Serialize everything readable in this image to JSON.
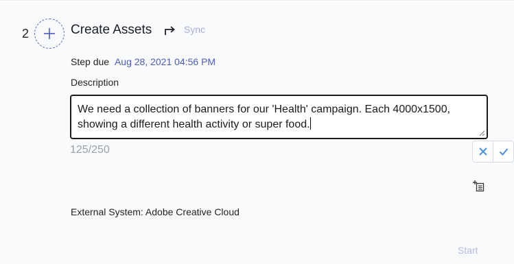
{
  "step": {
    "number": "2",
    "title": "Create Assets",
    "sync_label": "Sync",
    "due_label": "Step due",
    "due_value": "Aug 28, 2021 04:56 PM",
    "description_label": "Description",
    "description_value": "We need a collection of banners for our 'Health' campaign. Each 4000x1500, showing a different health activity or super food.",
    "char_count": "125/250",
    "external_system": "External System: Adobe Creative Cloud",
    "start_label": "Start"
  },
  "colors": {
    "accent": "#4b5bc4",
    "sync": "#a7aedc",
    "start": "#b4bbe6",
    "cancel": "#4a90e2",
    "confirm": "#4a90e2"
  },
  "icons": [
    "plus-icon",
    "redo-arrow-icon",
    "close-icon",
    "check-icon",
    "add-text-icon",
    "resize-grip-icon"
  ]
}
